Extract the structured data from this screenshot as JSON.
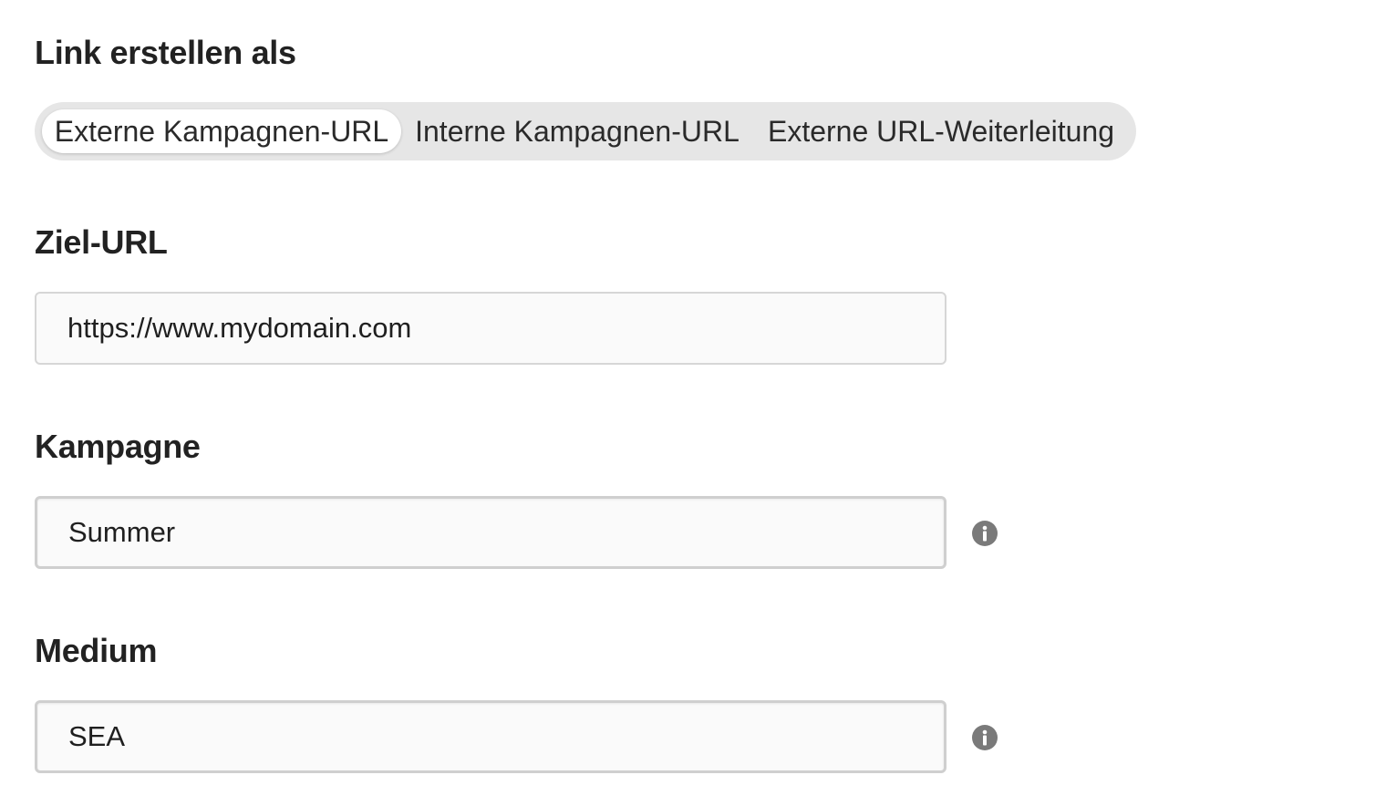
{
  "form": {
    "link_type": {
      "label": "Link erstellen als",
      "options": [
        {
          "label": "Externe Kampagnen-URL",
          "selected": true
        },
        {
          "label": "Interne Kampagnen-URL",
          "selected": false
        },
        {
          "label": "Externe URL-Weiterleitung",
          "selected": false
        }
      ]
    },
    "target_url": {
      "label": "Ziel-URL",
      "value": "https://www.mydomain.com"
    },
    "campaign": {
      "label": "Kampagne",
      "value": "Summer",
      "icon": "info-icon"
    },
    "medium": {
      "label": "Medium",
      "value": "SEA",
      "icon": "info-icon"
    }
  },
  "colors": {
    "segment_track": "#e6e6e6",
    "segment_active": "#ffffff",
    "input_border": "#d6d6d6",
    "info_icon": "#7a7a7a"
  }
}
